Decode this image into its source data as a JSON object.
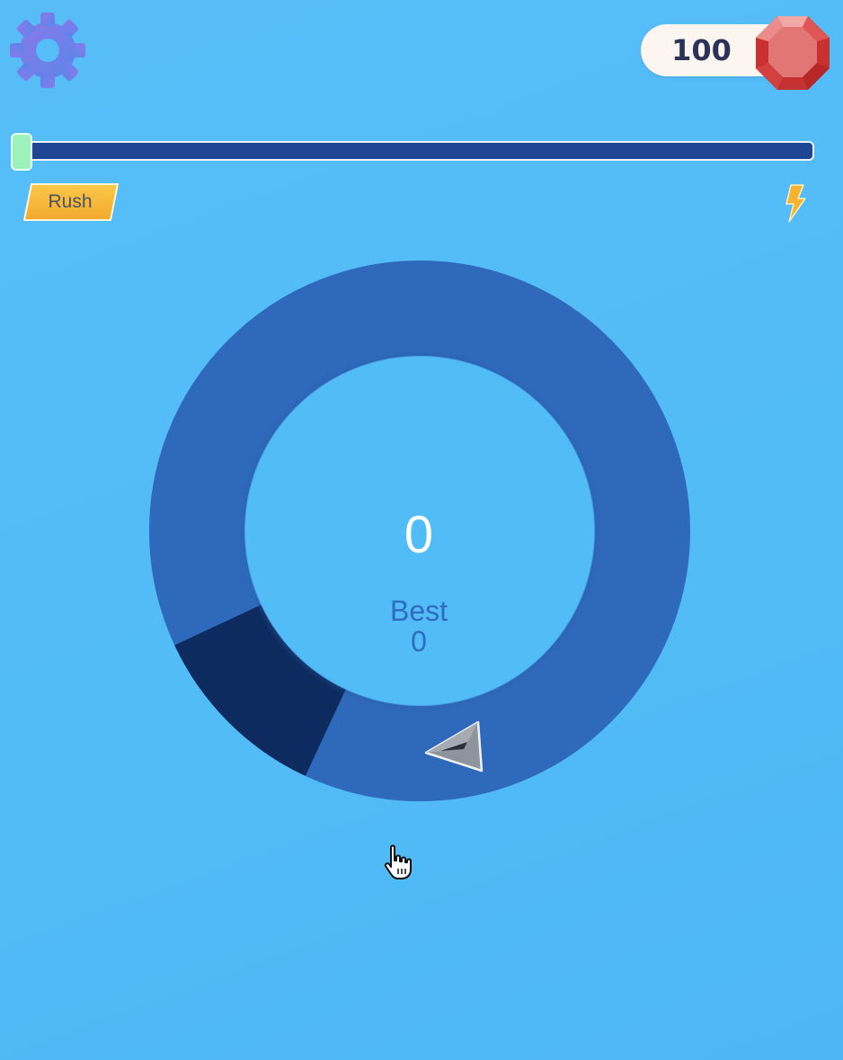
{
  "header": {
    "settings_icon": "gear-icon",
    "gem_count": "100",
    "gem_icon": "ruby-gem-icon"
  },
  "progress": {
    "fraction": 0.0,
    "start_label": "Rush",
    "end_icon": "lightning-bolt-icon"
  },
  "game": {
    "score": "0",
    "best_label": "Best",
    "best_value": "0",
    "player_icon": "paper-plane-icon",
    "hazard_segment_deg": [
      205,
      245
    ]
  },
  "colors": {
    "background": "#52bcf7",
    "ring": "#2f69bb",
    "hazard": "#0d2b5f",
    "track": "#1f4595",
    "handle": "#9df2bb",
    "gem_red": "#d9403f",
    "rush_badge": "#f5b53a",
    "gear": "#6f7fe6"
  }
}
